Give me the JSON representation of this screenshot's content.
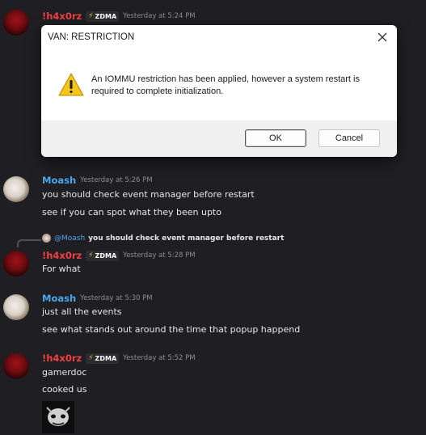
{
  "messages": [
    {
      "author": "!h4x0rz",
      "tag": "ZDMA",
      "time": "Yesterday at 5:24 PM"
    },
    {
      "author": "Moash",
      "time": "Yesterday at 5:26 PM",
      "lines": [
        "you should check event manager before restart",
        "see if you can spot what they been upto"
      ]
    },
    {
      "reply": {
        "mention": "@Moash",
        "text": "you should check event manager before restart"
      },
      "author": "!h4x0rz",
      "tag": "ZDMA",
      "time": "Yesterday at 5:28 PM",
      "lines": [
        "For what"
      ]
    },
    {
      "author": "Moash",
      "time": "Yesterday at 5:30 PM",
      "lines": [
        "just all the events",
        "see what stands out around the time that popup happend"
      ]
    },
    {
      "author": "!h4x0rz",
      "tag": "ZDMA",
      "time": "Yesterday at 5:52 PM",
      "lines": [
        "gamerdoc",
        "cooked us"
      ]
    }
  ],
  "dialog": {
    "title": "VAN: RESTRICTION",
    "message": "An IOMMU restriction has been applied, however a system restart is required to complete initialization.",
    "ok_label": "OK",
    "cancel_label": "Cancel",
    "icon": "warning-icon"
  },
  "colors": {
    "background": "#1f1f23",
    "name_red": "#f23f43",
    "name_blue": "#4aa6e8",
    "tag_bolt": "#f0b232"
  }
}
